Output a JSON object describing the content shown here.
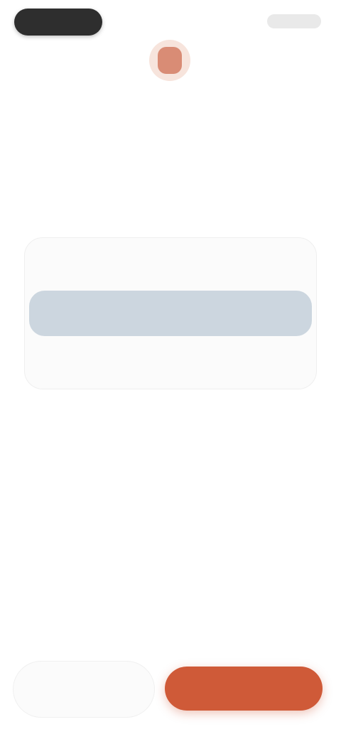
{
  "header": {
    "left_pill": "",
    "right_action": ""
  },
  "hero": {
    "icon": "app-icon",
    "title": "",
    "subtitle": ""
  },
  "selector": {
    "label": "",
    "selected_index": 1,
    "options": [
      {
        "label": ""
      },
      {
        "label": ""
      },
      {
        "label": ""
      }
    ]
  },
  "footer": {
    "secondary_label": "",
    "primary_label": ""
  },
  "colors": {
    "accent": "#cf5a38",
    "selected_option": "#ccd6df",
    "icon_tint": "#d98c75"
  }
}
